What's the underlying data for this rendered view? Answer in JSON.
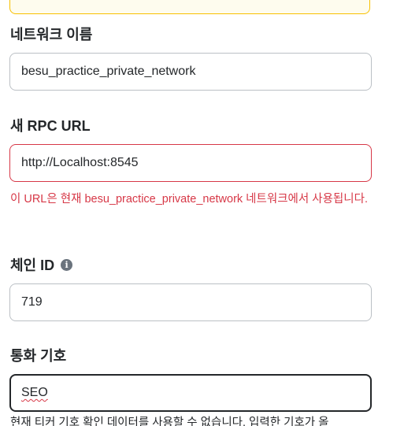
{
  "network_name": {
    "label": "네트워크 이름",
    "value": "besu_practice_private_network"
  },
  "rpc_url": {
    "label": "새 RPC URL",
    "value": "http://Localhost:8545",
    "error": "이 URL은 현재 besu_practice_private_network 네트워크에서 사용됩니다."
  },
  "chain_id": {
    "label": "체인 ID",
    "info_icon": "info-icon",
    "value": "719"
  },
  "currency_symbol": {
    "label": "통화 기호",
    "value": "SEO",
    "hint": "현재 티커 기호 확인 데이터를 사용할 수 없습니다. 입력한 기호가 올"
  },
  "colors": {
    "error": "#d73847",
    "warning_border": "#f8c000",
    "text": "#24272a",
    "border": "#bbc0c5"
  }
}
